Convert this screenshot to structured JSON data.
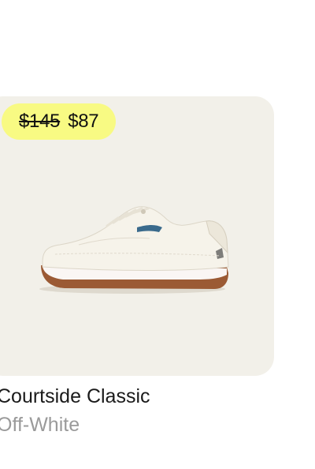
{
  "product": {
    "price_original": "$145",
    "price_sale": "$87",
    "name": "Courtside Classic",
    "color": "Off-White",
    "image": "white-sneaker-image",
    "colors": {
      "card_background": "#f2f0e9",
      "badge_background": "#f8fa83",
      "sole": "#9b5a34",
      "heel_accent": "#3a6a8c"
    }
  }
}
